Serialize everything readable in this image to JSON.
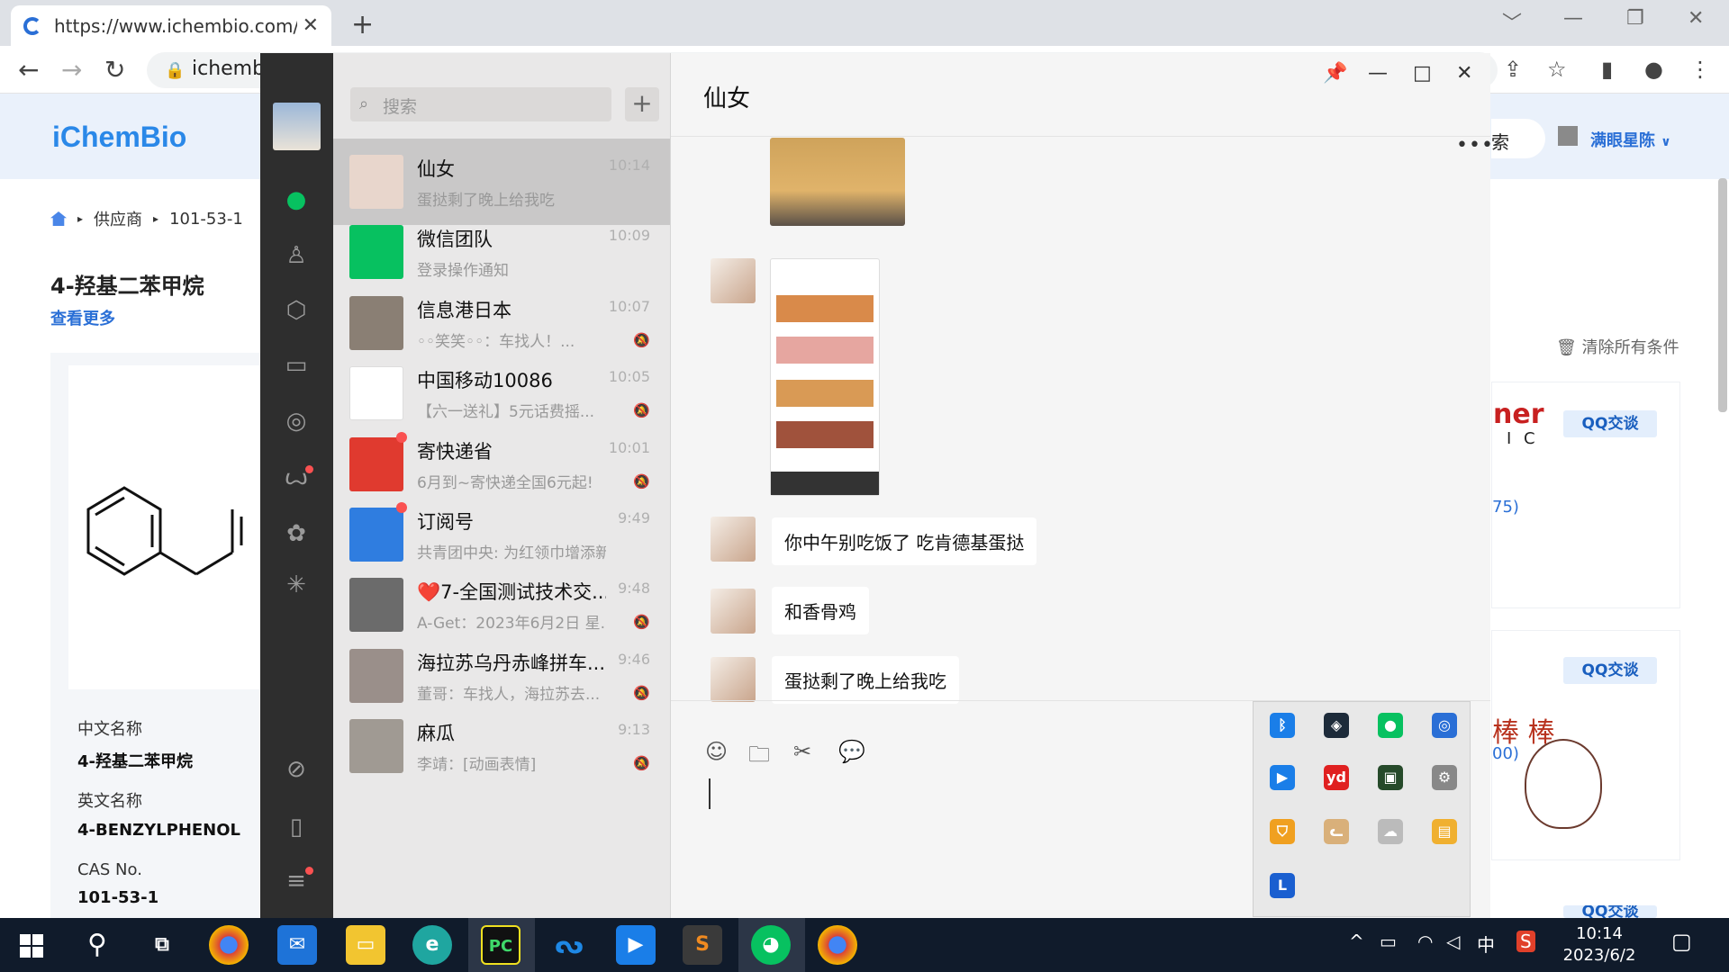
{
  "browser": {
    "tab_title": "https://www.ichembio.com/su",
    "tab_close": "✕",
    "new_tab": "+",
    "address": "ichembi",
    "win_min": "﹀",
    "win_minimize": "—",
    "win_restore": "❐",
    "win_close": "✕"
  },
  "site": {
    "logo": "iChemBio",
    "breadcrumb": [
      "供应商",
      "101-53-1"
    ],
    "product_title": "4-羟基二苯甲烷",
    "see_more": "查看更多",
    "props": [
      {
        "label": "中文名称",
        "value": "4-羟基二苯甲烷"
      },
      {
        "label": "英文名称",
        "value": "4-BENZYLPHENOL"
      },
      {
        "label": "CAS No.",
        "value": "101-53-1"
      }
    ],
    "search_fragment": "索",
    "user_name": "满眼星陈",
    "clear_all": "清除所有条件",
    "qq_label": "QQ交谈",
    "card1_brand": "ner",
    "card1_sub": "I C",
    "card1_count": "75)",
    "card2_count": "00)",
    "sticker_text": "棒 棒"
  },
  "wechat": {
    "search_placeholder": "搜索",
    "chats": [
      {
        "name": "仙女",
        "preview": "蛋挞剩了晚上给我吃",
        "time": "10:14",
        "muted": false,
        "active": true,
        "color": "#e8d6cc"
      },
      {
        "name": "微信团队",
        "preview": "登录操作通知",
        "time": "10:09",
        "muted": false,
        "color": "#07c160"
      },
      {
        "name": "信息港日本",
        "preview": "◦◦笑笑◦◦：车找人！...",
        "time": "10:07",
        "muted": true,
        "color": "#8a7f74"
      },
      {
        "name": "中国移动10086",
        "preview": "【六一送礼】5元话费摇...",
        "time": "10:05",
        "muted": true,
        "color": "#ffffff"
      },
      {
        "name": "寄快递省",
        "preview": "6月到~寄快递全国6元起!",
        "time": "10:01",
        "muted": true,
        "color": "#e03a2f",
        "dot": true
      },
      {
        "name": "订阅号",
        "preview": "共青团中央: 为红领巾增添新...",
        "time": "9:49",
        "muted": false,
        "color": "#2f7de0",
        "dot": true
      },
      {
        "name": "❤️7-全国测试技术交...",
        "preview": "A-Get：2023年6月2日 星...",
        "time": "9:48",
        "muted": true,
        "color": "#6b6b6b"
      },
      {
        "name": "海拉苏乌丹赤峰拼车...",
        "preview": "董哥：车找人，海拉苏去...",
        "time": "9:46",
        "muted": true,
        "color": "#9a8f8a"
      },
      {
        "name": "麻瓜",
        "preview": "李靖：[动画表情]",
        "time": "9:13",
        "muted": true,
        "color": "#a09a93"
      }
    ],
    "chat_title": "仙女",
    "more": "•••",
    "messages": [
      {
        "type": "image",
        "desc": "bear-photo"
      },
      {
        "type": "image",
        "desc": "order-screenshot"
      },
      {
        "type": "text",
        "text": "你中午别吃饭了 吃肯德基蛋挞"
      },
      {
        "type": "text",
        "text": "和香骨鸡"
      },
      {
        "type": "text",
        "text": "蛋挞剩了晚上给我吃"
      }
    ]
  },
  "taskbar": {
    "ime": "中",
    "time": "10:14",
    "date": "2023/6/2"
  }
}
